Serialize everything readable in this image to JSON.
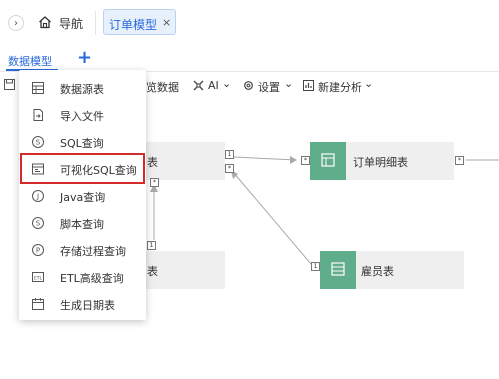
{
  "topbar": {
    "collapse_glyph": "›",
    "nav_label": "导航",
    "active_tab_label": "订单模型",
    "close_glyph": "×"
  },
  "subtabs": {
    "active_label": "数据模型",
    "add_glyph": "+"
  },
  "toolbar": {
    "preview_label": "览数据",
    "ai_label": "AI",
    "settings_label": "设置",
    "new_analysis_label": "新建分析",
    "chevron": "⌄"
  },
  "canvas": {
    "node_left_top_label": "表",
    "node_order_detail_label": "订单明细表",
    "node_left_bottom_label": "表",
    "node_employee_label": "雇员表",
    "port_one": "1",
    "port_many": "*"
  },
  "menu": {
    "items": [
      {
        "label": "数据源表",
        "icon": "table-icon"
      },
      {
        "label": "导入文件",
        "icon": "file-import-icon"
      },
      {
        "label": "SQL查询",
        "icon": "sql-query-icon"
      },
      {
        "label": "可视化SQL查询",
        "icon": "visual-sql-icon"
      },
      {
        "label": "Java查询",
        "icon": "java-query-icon"
      },
      {
        "label": "脚本查询",
        "icon": "script-query-icon"
      },
      {
        "label": "存储过程查询",
        "icon": "stored-procedure-icon"
      },
      {
        "label": "ETL高级查询",
        "icon": "etl-icon"
      },
      {
        "label": "生成日期表",
        "icon": "calendar-icon"
      }
    ],
    "highlighted_index": 3
  },
  "colors": {
    "accent": "#2a6ad8",
    "node_icon": "#5fad8b",
    "highlight": "#d42a2a"
  }
}
